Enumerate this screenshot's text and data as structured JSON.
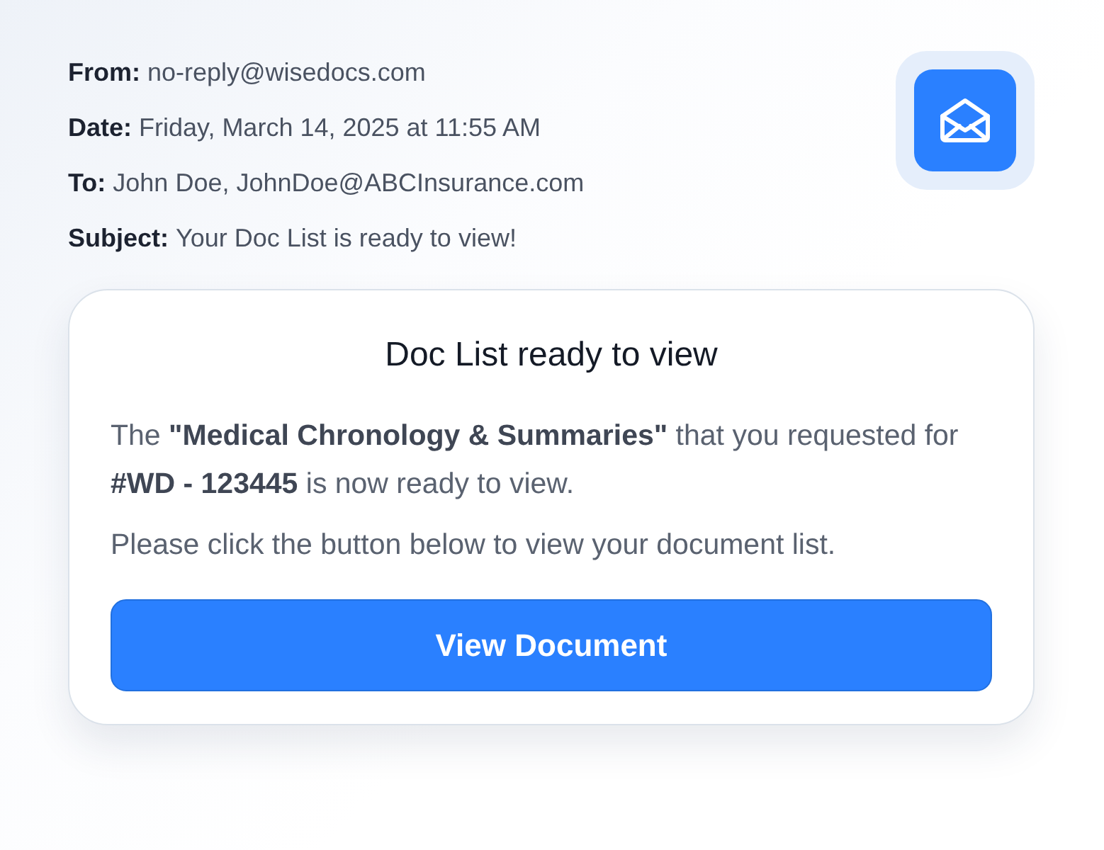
{
  "email_header": [
    {
      "label": "From:",
      "value": "no-reply@wisedocs.com"
    },
    {
      "label": "Date:",
      "value": "Friday, March 14, 2025 at 11:55 AM"
    },
    {
      "label": "To:",
      "value": "John Doe, JohnDoe@ABCInsurance.com"
    },
    {
      "label": "Subject:",
      "value": "Your Doc List is ready to view!"
    }
  ],
  "card": {
    "title": "Doc List ready to view",
    "paragraphs": [
      "The **\"Medical Chronology & Summaries\"** that you requested for **#WD - 123445** is now ready to view.",
      "Please click the button below to view your document list."
    ],
    "button": "View Document"
  }
}
